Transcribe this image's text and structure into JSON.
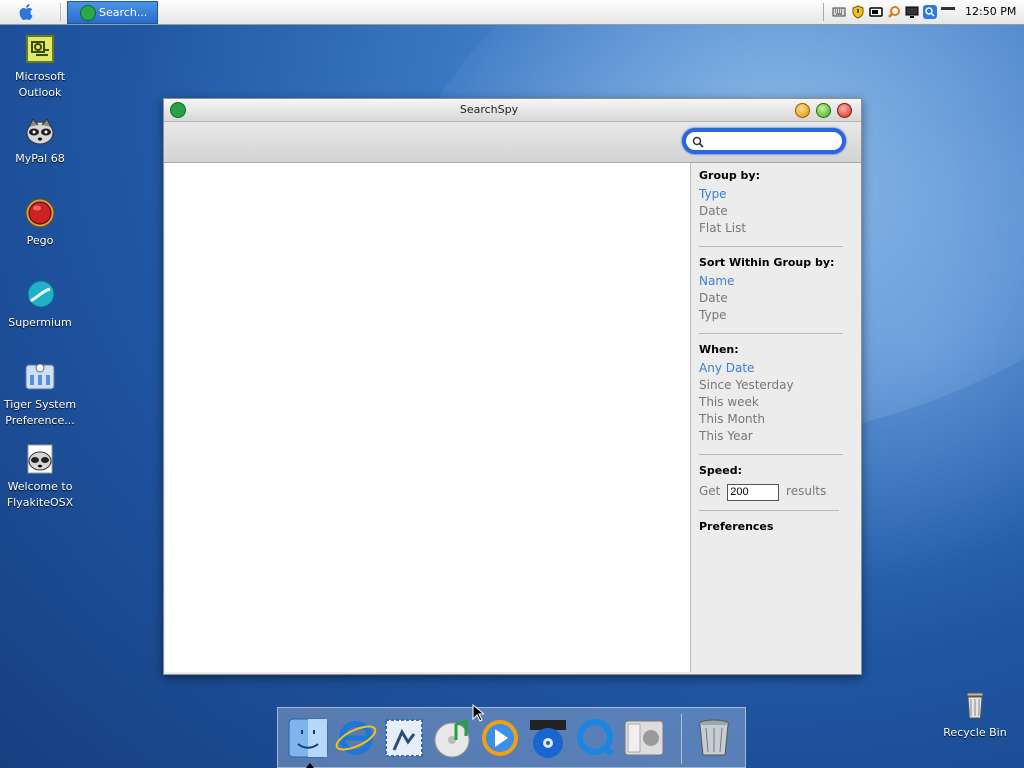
{
  "menubar": {
    "apple_icon": "apple-icon",
    "taskbar_button": {
      "label": "Search...",
      "icon": "searchspy-icon"
    },
    "tray_icons": [
      "keyboard-icon",
      "shield-icon",
      "battery-icon",
      "magnifier-orange-icon",
      "monitor-icon",
      "search-blue-icon",
      "volume-icon"
    ],
    "clock": "12:50 PM"
  },
  "desktop_icons": [
    {
      "label": "Microsoft Outlook",
      "icon": "outlook-icon"
    },
    {
      "label": "MyPal 68",
      "icon": "raccoon-icon"
    },
    {
      "label": "Pego",
      "icon": "pego-icon"
    },
    {
      "label": "Supermium",
      "icon": "supermium-icon"
    },
    {
      "label": "Tiger System Preference...",
      "icon": "system-preferences-icon"
    },
    {
      "label": "Welcome to FlyakiteOSX",
      "icon": "flyakite-icon"
    },
    {
      "label": "Recycle Bin",
      "icon": "recycle-bin-icon"
    }
  ],
  "window": {
    "title": "SearchSpy",
    "search": {
      "value": "",
      "placeholder": ""
    },
    "group_by": {
      "heading": "Group by:",
      "options": [
        "Type",
        "Date",
        "Flat List"
      ],
      "selected": "Type"
    },
    "sort_within": {
      "heading": "Sort Within Group by:",
      "options": [
        "Name",
        "Date",
        "Type"
      ],
      "selected": "Name"
    },
    "when": {
      "heading": "When:",
      "options": [
        "Any Date",
        "Since Yesterday",
        "This week",
        "This Month",
        "This Year"
      ],
      "selected": "Any Date"
    },
    "speed": {
      "heading": "Speed:",
      "get_label": "Get",
      "value": "200",
      "results_label": "results"
    },
    "preferences": "Preferences"
  },
  "dock": {
    "items": [
      "finder-icon",
      "internet-explorer-icon",
      "mail-icon",
      "itunes-icon",
      "media-player-icon",
      "dvd-player-icon",
      "quicktime-icon",
      "boot-camp-icon",
      "trash-icon"
    ]
  },
  "colors": {
    "accent": "#3b7fd0",
    "search_focus": "#2a66e0"
  }
}
